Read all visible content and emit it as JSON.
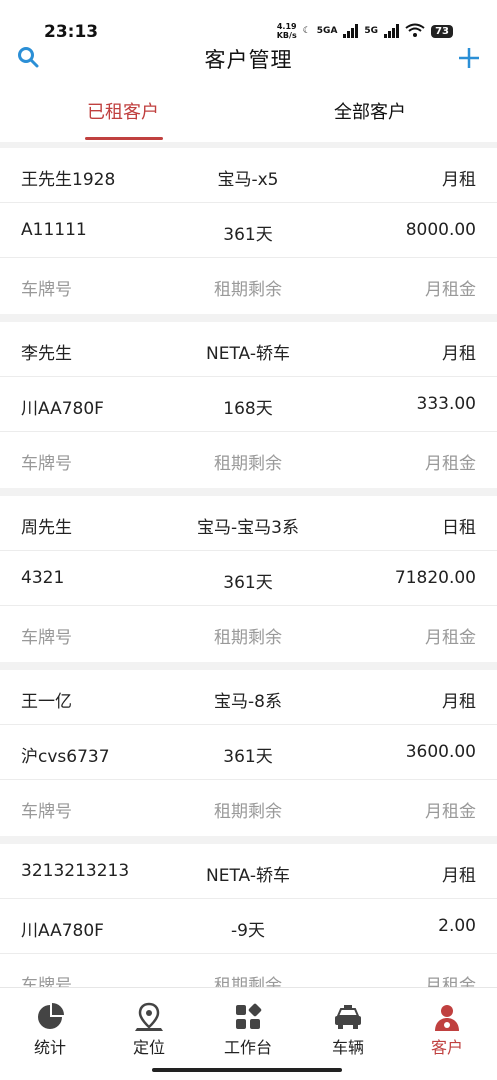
{
  "status_bar": {
    "time": "23:13",
    "speed_value": "4.19",
    "speed_unit": "KB/s",
    "net1": "5GA",
    "net2": "5G",
    "battery": "73"
  },
  "header": {
    "title": "客户管理",
    "search_icon": "search-icon",
    "add_icon": "plus-icon"
  },
  "tabs": [
    {
      "label": "已租客户",
      "active": true
    },
    {
      "label": "全部客户",
      "active": false
    }
  ],
  "customers": [
    {
      "name": "王先生1928",
      "car": "宝马-x5",
      "rent_type": "月租",
      "plate": "A11111",
      "remaining": "361天",
      "rent": "8000.00",
      "plate_label": "车牌号",
      "remaining_label": "租期剩余",
      "rent_label": "月租金"
    },
    {
      "name": "李先生",
      "car": "NETA-轿车",
      "rent_type": "月租",
      "plate": "川AA780F",
      "remaining": "168天",
      "rent": "333.00",
      "plate_label": "车牌号",
      "remaining_label": "租期剩余",
      "rent_label": "月租金"
    },
    {
      "name": "周先生",
      "car": "宝马-宝马3系",
      "rent_type": "日租",
      "plate": "4321",
      "remaining": "361天",
      "rent": "71820.00",
      "plate_label": "车牌号",
      "remaining_label": "租期剩余",
      "rent_label": "月租金"
    },
    {
      "name": "王一亿",
      "car": "宝马-8系",
      "rent_type": "月租",
      "plate": "沪cvs6737",
      "remaining": "361天",
      "rent": "3600.00",
      "plate_label": "车牌号",
      "remaining_label": "租期剩余",
      "rent_label": "月租金"
    },
    {
      "name": "3213213213",
      "car": "NETA-轿车",
      "rent_type": "月租",
      "plate": "川AA780F",
      "remaining": "-9天",
      "rent": "2.00",
      "plate_label": "车牌号",
      "remaining_label": "租期剩余",
      "rent_label": "月租金"
    }
  ],
  "bottom_nav": [
    {
      "label": "统计",
      "icon": "pie-chart-icon",
      "active": false
    },
    {
      "label": "定位",
      "icon": "location-pin-icon",
      "active": false
    },
    {
      "label": "工作台",
      "icon": "dashboard-icon",
      "active": false
    },
    {
      "label": "车辆",
      "icon": "car-icon",
      "active": false
    },
    {
      "label": "客户",
      "icon": "user-icon",
      "active": true
    }
  ],
  "colors": {
    "accent": "#c0403f",
    "muted_text": "#999999",
    "background": "#f2f2f2"
  }
}
